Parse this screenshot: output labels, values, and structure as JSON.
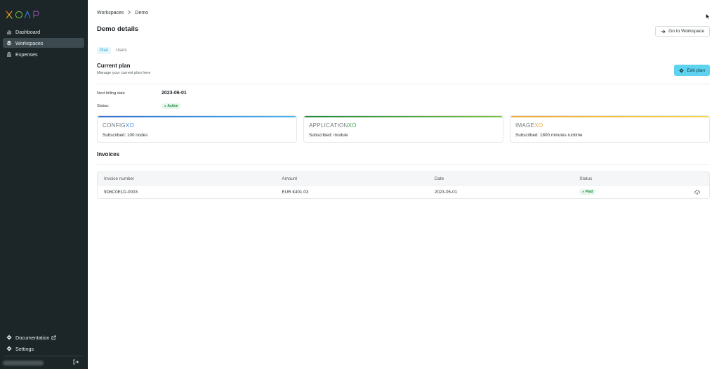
{
  "app": {
    "logo_text": "XOAP",
    "colors": {
      "sidebar_bg": "#1c2528",
      "accent": "#5ed3ef",
      "active_nav": "#3c4a4f",
      "paid_badge": "#1e8c43"
    }
  },
  "sidebar": {
    "items": [
      {
        "label": "Dashboard",
        "icon": "bar-chart-icon",
        "active": false
      },
      {
        "label": "Workspaces",
        "icon": "layers-icon",
        "active": true
      },
      {
        "label": "Expenses",
        "icon": "bank-icon",
        "active": false
      }
    ],
    "bottom_items": [
      {
        "label": "Documentation",
        "icon": "gear-icon",
        "external_icon": "external-link-icon"
      },
      {
        "label": "Settings",
        "icon": "gear-icon"
      }
    ],
    "logout_icon": "logout-icon"
  },
  "breadcrumb": {
    "items": [
      "Workspaces",
      "Demo"
    ]
  },
  "header": {
    "title": "Demo details",
    "goto_button": "Go to Workspace"
  },
  "tabs": [
    {
      "label": "Plan",
      "active": true
    },
    {
      "label": "Users",
      "active": false
    }
  ],
  "plan": {
    "title": "Current plan",
    "subtitle": "Manage your current plan here",
    "edit_button": "Edit plan",
    "billing_label": "Next billing date",
    "billing_value": "2023-06-01",
    "status_label": "Status:",
    "status_value": "Active"
  },
  "products": [
    {
      "name_prefix": "CONFIG",
      "name_suffix": "XO",
      "subscribed": "Subscribed: 100 nodes",
      "color": "#3b8be0"
    },
    {
      "name_prefix": "APPLICATION",
      "name_suffix": "XO",
      "subscribed": "Subscribed: module",
      "color": "#3da64a"
    },
    {
      "name_prefix": "IMAGE",
      "name_suffix": "XO",
      "subscribed": "Subscribed: 1800 minutes runtime",
      "color": "#f2c53d"
    }
  ],
  "invoices": {
    "title": "Invoices",
    "columns": [
      "Invoice number",
      "Amount",
      "Date",
      "Status"
    ],
    "rows": [
      {
        "number": "9D6C0E1D-0003",
        "amount": "EUR €401.03",
        "date": "2023-05-01",
        "status": "Paid",
        "action_icon": "download-cloud-icon"
      }
    ]
  }
}
